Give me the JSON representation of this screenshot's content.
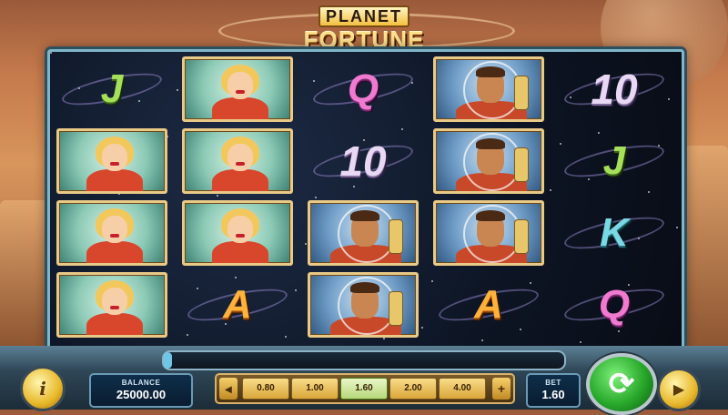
{
  "game": {
    "logo_top": "PLANET",
    "logo_bottom": "FORTUNE"
  },
  "reels": [
    [
      "J",
      "woman",
      "woman",
      "woman"
    ],
    [
      "woman",
      "woman",
      "woman",
      "A"
    ],
    [
      "Q",
      "10",
      "astronaut",
      "astronaut"
    ],
    [
      "astronaut",
      "astronaut",
      "astronaut",
      "A"
    ],
    [
      "10",
      "J",
      "K",
      "Q"
    ]
  ],
  "hud": {
    "balance_label": "BALANCE",
    "balance_value": "25000.00",
    "bet_label": "BET",
    "bet_value": "1.60",
    "bet_options": [
      "0.80",
      "1.00",
      "1.60",
      "2.00",
      "4.00"
    ],
    "selected_bet": "1.60",
    "decrease_label": "◂",
    "increase_label": "+",
    "info_label": "i",
    "spin_label": "⟳",
    "autoplay_label": "▶"
  },
  "progress_fraction": 0.02,
  "colors": {
    "spin": "#28a82a",
    "frame": "#7fb6c9",
    "selected_chip": "#b6d77a"
  }
}
